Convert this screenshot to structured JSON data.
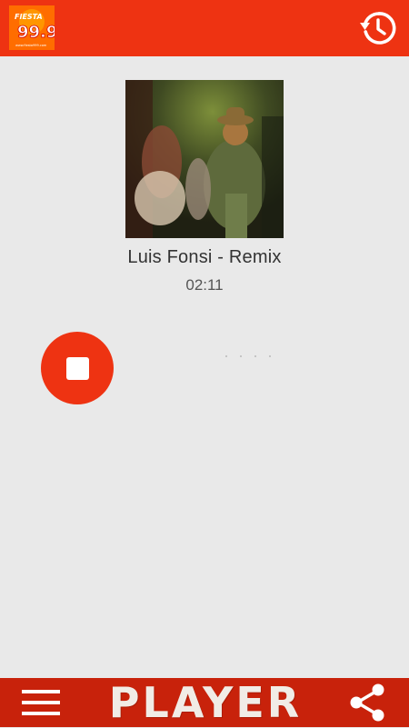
{
  "header": {
    "logo": {
      "station_name": "FIESTA",
      "frequency": "99.9",
      "website": "www.fiesta999.com"
    },
    "history_icon": "history-icon"
  },
  "now_playing": {
    "title": "Luis Fonsi - Remix",
    "elapsed": "02:11"
  },
  "controls": {
    "stop_icon": "stop-icon",
    "loading_icon": "loading-dots-icon"
  },
  "footer": {
    "menu_icon": "hamburger-menu-icon",
    "title": "PLAYER",
    "share_icon": "share-icon"
  },
  "colors": {
    "primary": "#ee3312",
    "footer": "#c8220b",
    "background": "#e9e9e9",
    "logo_orange": "#ff6d00"
  }
}
